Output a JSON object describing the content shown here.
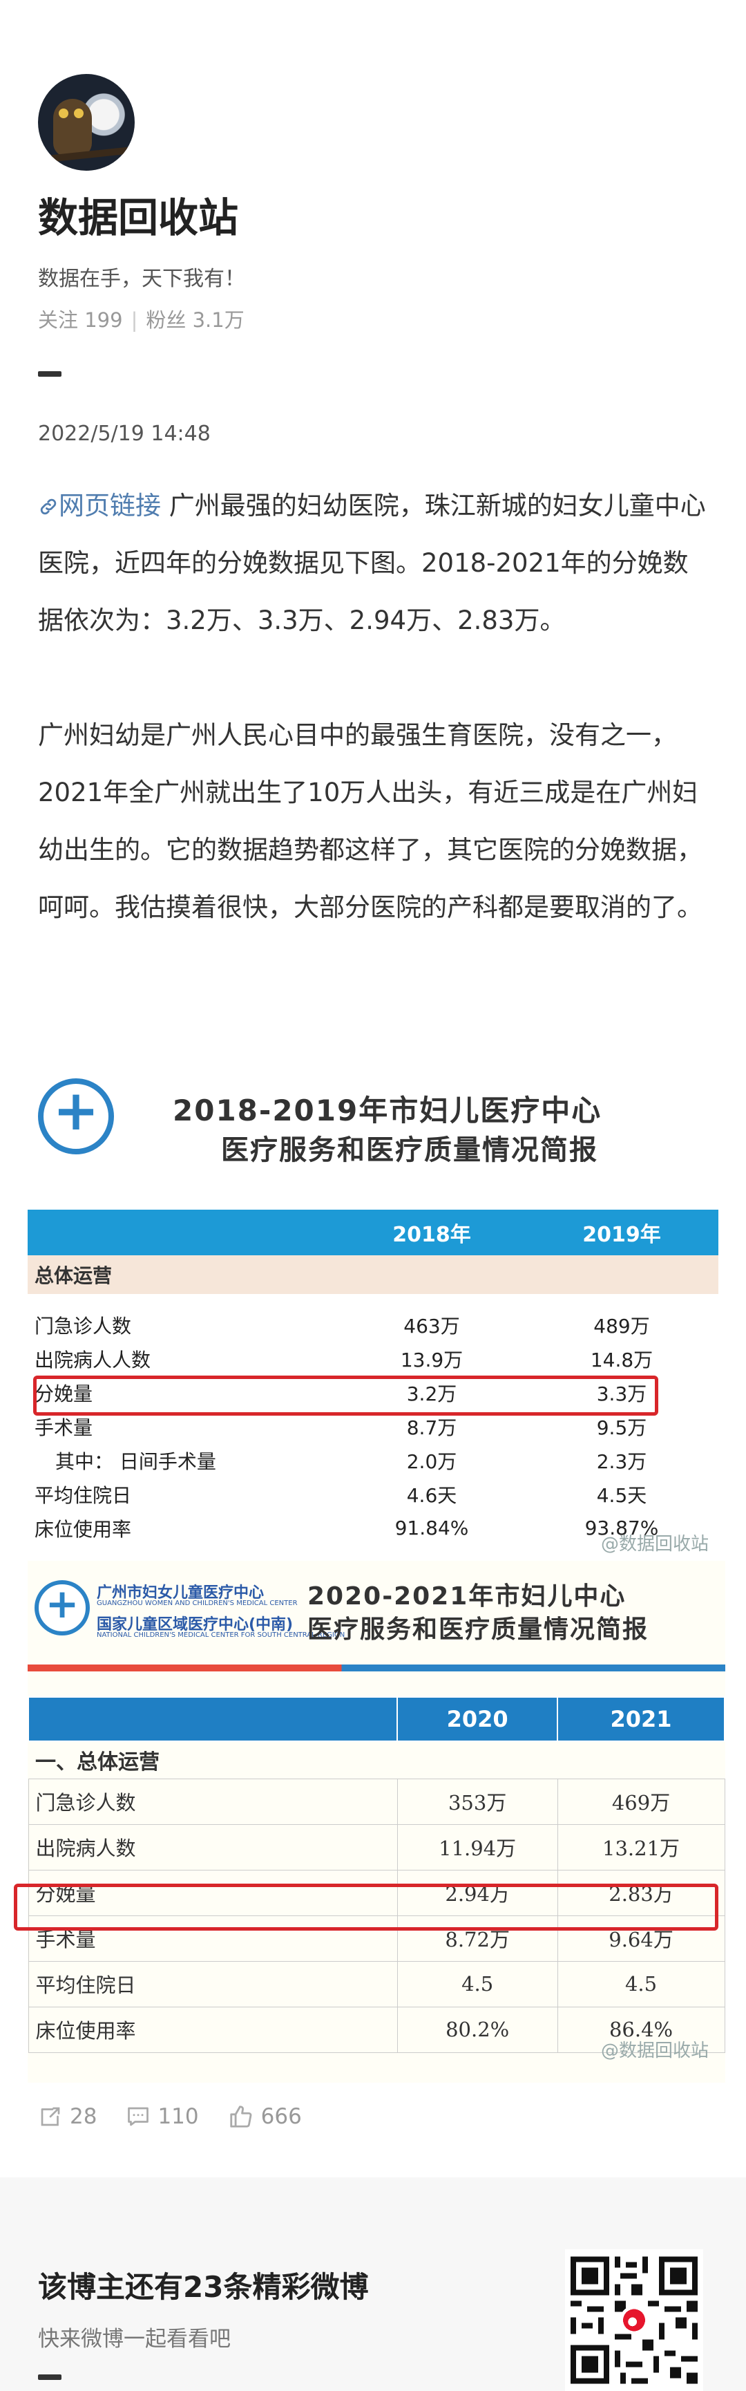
{
  "profile": {
    "username": "数据回收站",
    "bio": "数据在手，天下我有！",
    "follows_label": "关注 199",
    "fans_label": "粉丝 3.1万"
  },
  "post": {
    "timestamp": "2022/5/19 14:48",
    "link_label": "网页链接",
    "para1": "广州最强的妇幼医院，珠江新城的妇女儿童中心医院，近四年的分娩数据见下图。2018-2021年的分娩数据依次为：3.2万、3.3万、2.94万、2.83万。",
    "para2": "广州妇幼是广州人民心目中的最强生育医院，没有之一，2021年全广州就出生了10万人出头，有近三成是在广州妇幼出生的。它的数据趋势都这样了，其它医院的分娩数据，呵呵。我估摸着很快，大部分医院的产科都是要取消的了。"
  },
  "report1": {
    "title_line1": "2018-2019年市妇儿医疗中心",
    "title_line2": "医疗服务和医疗质量情况简报",
    "col1": "2018年",
    "col2": "2019年",
    "section": "总体运营",
    "rows": [
      {
        "label": "门急诊人数",
        "v1": "463万",
        "v2": "489万"
      },
      {
        "label": "出院病人人数",
        "v1": "13.9万",
        "v2": "14.8万"
      },
      {
        "label": "分娩量",
        "v1": "3.2万",
        "v2": "3.3万"
      },
      {
        "label": "手术量",
        "v1": "8.7万",
        "v2": "9.5万"
      },
      {
        "label": "其中：  日间手术量",
        "v1": "2.0万",
        "v2": "2.3万"
      },
      {
        "label": "平均住院日",
        "v1": "4.6天",
        "v2": "4.5天"
      },
      {
        "label": "床位使用率",
        "v1": "91.84%",
        "v2": "93.87%"
      }
    ],
    "watermark": "@数据回收站"
  },
  "report2": {
    "org_line1": "广州市妇女儿童医疗中心",
    "org_line1_sub": "GUANGZHOU WOMEN AND CHILDREN'S MEDICAL CENTER",
    "org_line2": "国家儿童区域医疗中心(中南)",
    "org_line2_sub": "NATIONAL CHILDREN'S MEDICAL CENTER FOR SOUTH CENTRAL REGION",
    "title_line1": "2020-2021年市妇儿中心",
    "title_line2": "医疗服务和医疗质量情况简报",
    "col1": "2020",
    "col2": "2021",
    "section": "一、总体运营",
    "rows": [
      {
        "label": "门急诊人数",
        "v1": "353万",
        "v2": "469万"
      },
      {
        "label": "出院病人数",
        "v1": "11.94万",
        "v2": "13.21万"
      },
      {
        "label": "分娩量",
        "v1": "2.94万",
        "v2": "2.83万"
      },
      {
        "label": "手术量",
        "v1": "8.72万",
        "v2": "9.64万"
      },
      {
        "label": "平均住院日",
        "v1": "4.5",
        "v2": "4.5"
      },
      {
        "label": "床位使用率",
        "v1": "80.2%",
        "v2": "86.4%"
      }
    ],
    "watermark": "@数据回收站"
  },
  "actions": {
    "reposts": "28",
    "comments": "110",
    "likes": "666"
  },
  "promo": {
    "title": "该博主还有23条精彩微博",
    "subtitle": "快来微博一起看看吧"
  },
  "colors": {
    "link": "#507daf",
    "highlight": "#d8262a",
    "table_header_1": "#1d9ad6",
    "table_header_2": "#1f7fc4"
  }
}
